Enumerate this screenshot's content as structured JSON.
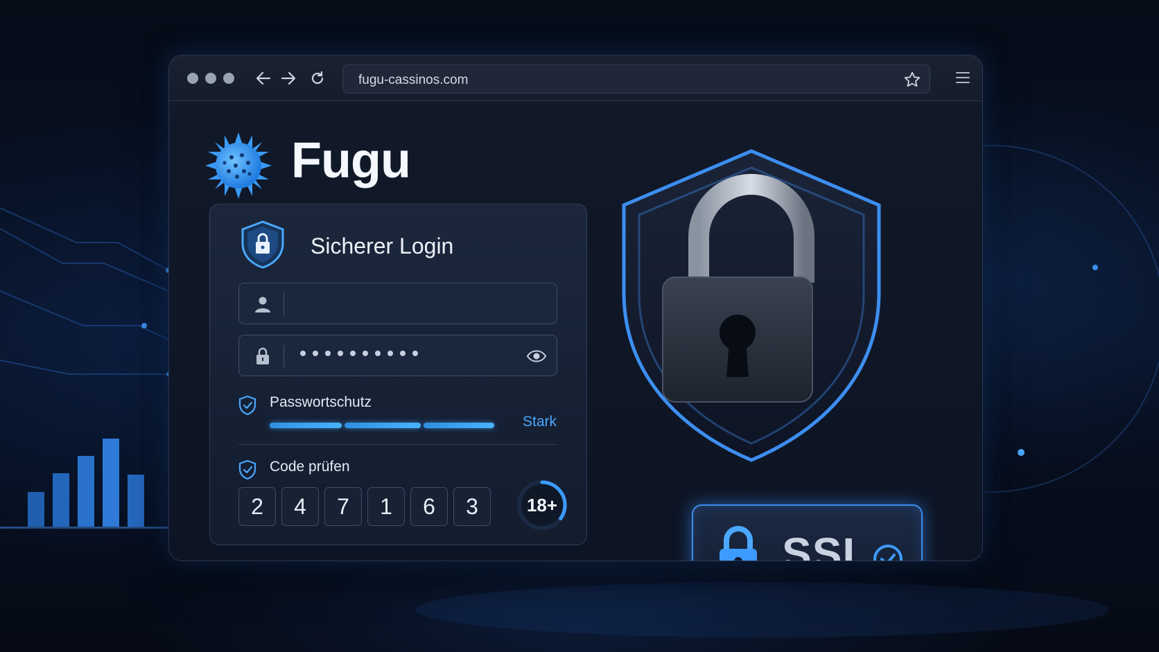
{
  "browser": {
    "url": "fugu-cassinos.com",
    "icons": [
      "back-arrow-icon",
      "forward-arrow-icon",
      "reload-icon",
      "star-icon",
      "menu-icon"
    ]
  },
  "brand": {
    "name": "Fugu",
    "icon": "pufferfish-icon"
  },
  "login": {
    "title": "Sicherer Login",
    "username_value": "",
    "password_dots": 10,
    "password_protection_label": "Passwortschutz",
    "strength_label": "Stark",
    "strength_segments_filled": 3,
    "code_label": "Code prüfen",
    "code_digits": [
      "2",
      "4",
      "7",
      "1",
      "6",
      "3"
    ],
    "age_badge": "18+",
    "age_ring_progress": 0.35
  },
  "security": {
    "ssl_label": "SSL"
  },
  "colors": {
    "accent": "#3d9bff",
    "background": "#081226",
    "panel": "#141e30"
  }
}
